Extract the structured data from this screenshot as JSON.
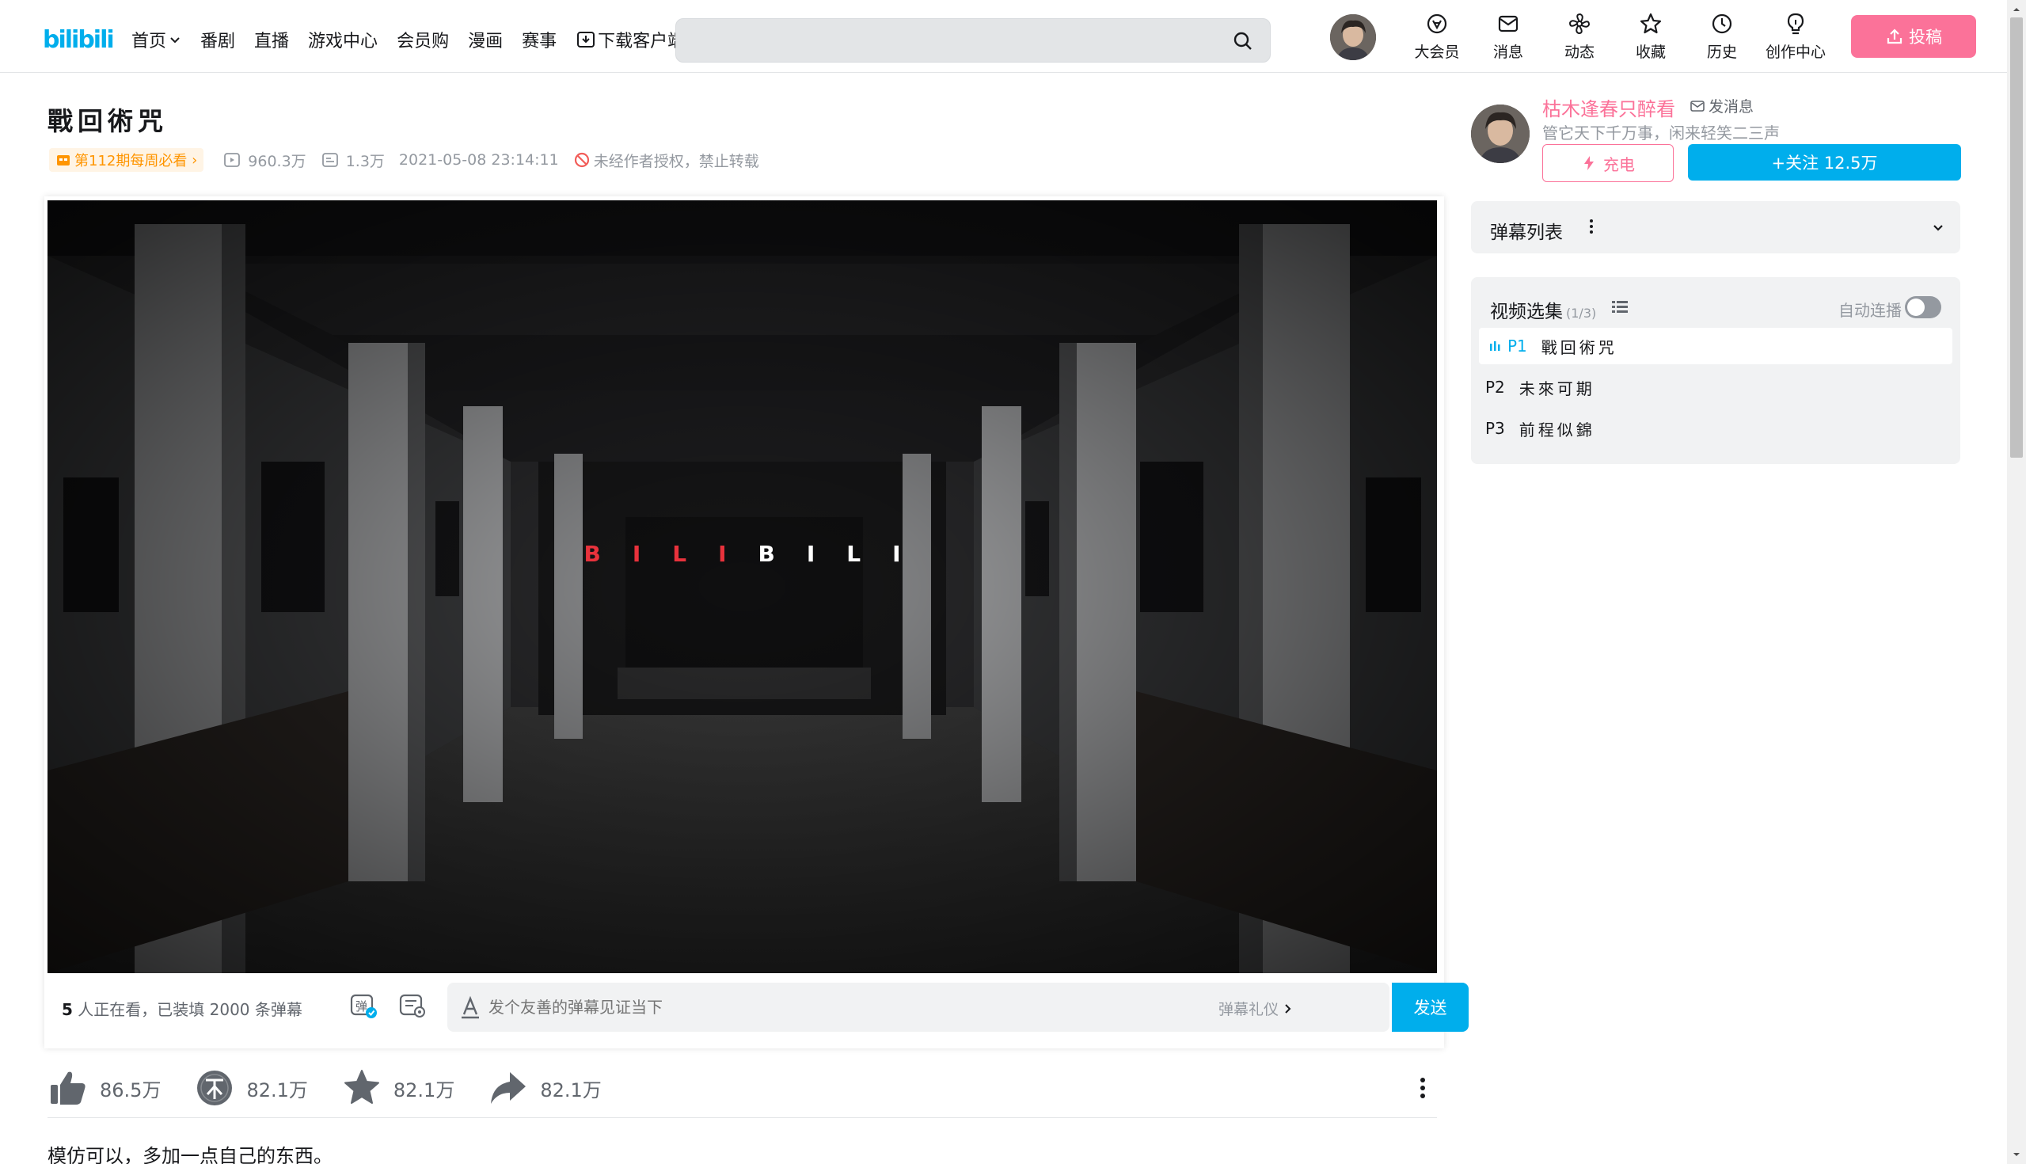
{
  "header": {
    "logo_text": "bilibili",
    "nav": [
      {
        "label": "首页",
        "has_dropdown": true
      },
      {
        "label": "番剧"
      },
      {
        "label": "直播"
      },
      {
        "label": "游戏中心"
      },
      {
        "label": "会员购"
      },
      {
        "label": "漫画"
      },
      {
        "label": "赛事"
      },
      {
        "label": "下载客户端",
        "icon": "download-icon"
      }
    ],
    "search_placeholder": "",
    "right_nav": [
      {
        "label": "大会员",
        "icon": "vip-icon"
      },
      {
        "label": "消息",
        "icon": "message-icon"
      },
      {
        "label": "动态",
        "icon": "dynamic-icon"
      },
      {
        "label": "收藏",
        "icon": "star-icon"
      },
      {
        "label": "历史",
        "icon": "history-icon"
      },
      {
        "label": "创作中心",
        "icon": "bulb-icon"
      }
    ],
    "upload_label": "投稿"
  },
  "video": {
    "title": "戰回術咒",
    "weekly_badge": "第112期每周必看",
    "views": "960.3万",
    "danmaku_count": "1.3万",
    "publish_time": "2021-05-08 23:14:11",
    "no_repost": "未经作者授权，禁止转载",
    "frame_text": [
      "B",
      "I",
      "L",
      "I",
      "B",
      "I",
      "L",
      "I"
    ],
    "frame_text_colors": [
      "#e8323c",
      "#e8323c",
      "#e8323c",
      "#e8323c",
      "#ffffff",
      "#ffffff",
      "#ffffff",
      "#ffffff"
    ]
  },
  "danmaku_bar": {
    "viewers_num": "5",
    "viewers_text": " 人正在看，已装填 2000 条弹幕",
    "input_placeholder": "发个友善的弹幕见证当下",
    "etiquette": "弹幕礼仪",
    "send_label": "发送"
  },
  "toolbar": {
    "like": "86.5万",
    "coin": "82.1万",
    "favorite": "82.1万",
    "share": "82.1万"
  },
  "description": "模仿可以，多加一点自己的东西。",
  "uploader": {
    "name": "枯木逢春只醉看",
    "send_message": "发消息",
    "signature": "管它天下千万事，闲来轻笑二三声",
    "charge_label": "充电",
    "follow_label": "+关注 12.5万"
  },
  "danmaku_list": {
    "title": "弹幕列表"
  },
  "playlist": {
    "title": "视频选集",
    "count": "(1/3)",
    "autoplay_label": "自动连播",
    "autoplay_on": false,
    "items": [
      {
        "no": "P1",
        "name": "戰回術咒",
        "active": true
      },
      {
        "no": "P2",
        "name": "未來可期",
        "active": false
      },
      {
        "no": "P3",
        "name": "前程似錦",
        "active": false
      }
    ]
  },
  "colors": {
    "brand_blue": "#00aeec",
    "brand_pink": "#fb7299",
    "badge_orange": "#ff9500"
  }
}
